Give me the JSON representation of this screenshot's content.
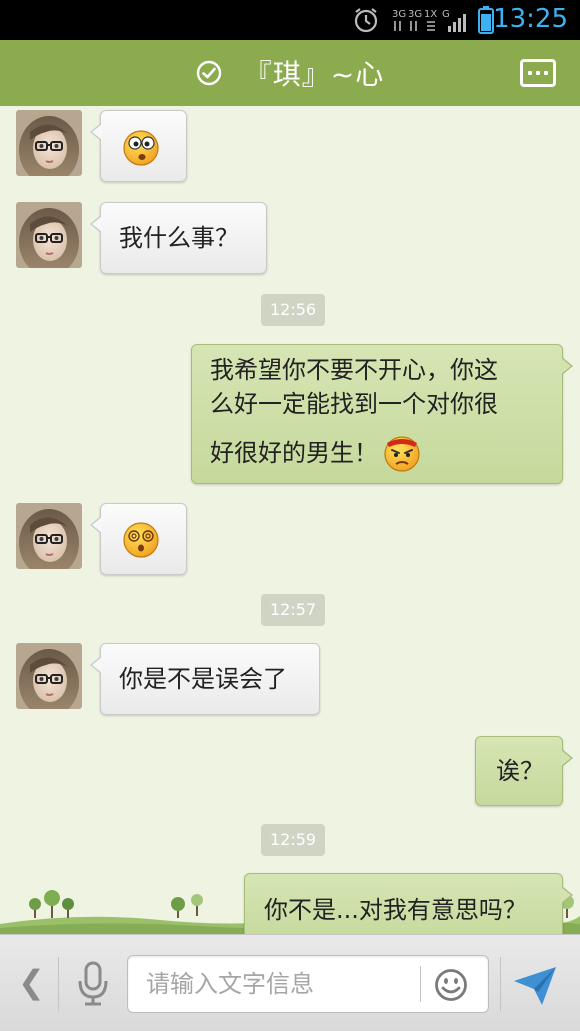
{
  "status_bar": {
    "time": "13:25",
    "network_label": "3G 3G 1X G",
    "icons": [
      "alarm-icon",
      "signal-icon",
      "battery-icon"
    ]
  },
  "header": {
    "title": "『琪』~心",
    "icons": [
      "verified-check-icon",
      "more-menu-icon"
    ]
  },
  "messages": [
    {
      "side": "in",
      "type": "emoji",
      "emoji": "surprised-face"
    },
    {
      "side": "in",
      "type": "text",
      "text": "我什么事？"
    },
    {
      "type": "time",
      "text": "12:56"
    },
    {
      "side": "out",
      "type": "text",
      "lines": [
        "我希望你不要不开心，你这",
        "么好一定能找到一个对你很",
        "好很好的男生！"
      ],
      "emoji": "angry-face"
    },
    {
      "side": "in",
      "type": "emoji",
      "emoji": "dizzy-face"
    },
    {
      "type": "time",
      "text": "12:57"
    },
    {
      "side": "in",
      "type": "text",
      "text": "你是不是误会了"
    },
    {
      "side": "out",
      "type": "text",
      "text": "诶？"
    },
    {
      "type": "time",
      "text": "12:59"
    },
    {
      "side": "out",
      "type": "text",
      "text": "你不是...对我有意思吗？"
    }
  ],
  "input_bar": {
    "placeholder": "请输入文字信息",
    "icons": [
      "back-arrow-icon",
      "microphone-icon",
      "smiley-icon",
      "send-icon"
    ]
  },
  "colors": {
    "header_green": "#8cab4f",
    "chat_background": "#eef3e2",
    "outgoing_bubble": "#c9dca2",
    "incoming_bubble": "#f4f4f4",
    "time_accent": "#3ab3f0"
  }
}
